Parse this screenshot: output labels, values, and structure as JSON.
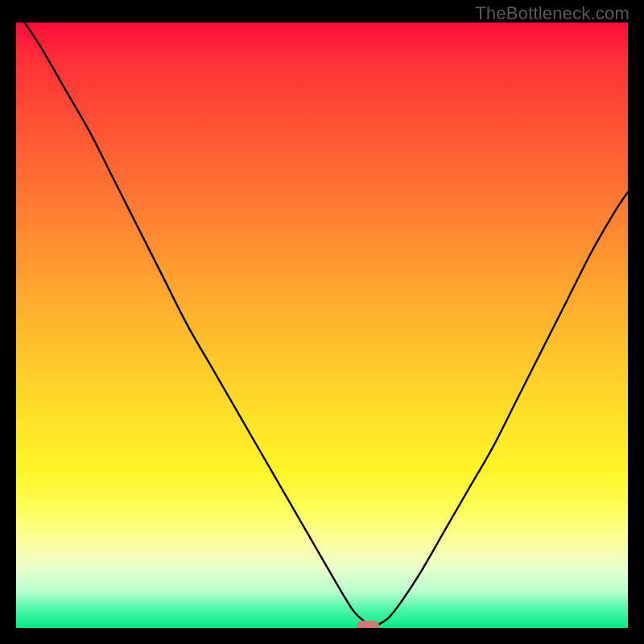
{
  "watermark": "TheBottleneck.com",
  "colors": {
    "page_bg": "#000000",
    "curve_stroke": "#000000",
    "marker_fill": "#cf7a75",
    "watermark_text": "#595959"
  },
  "chart_data": {
    "type": "line",
    "title": "",
    "xlabel": "",
    "ylabel": "",
    "xlim": [
      0,
      100
    ],
    "ylim": [
      0,
      100
    ],
    "grid": false,
    "legend": false,
    "series": [
      {
        "name": "curve",
        "x": [
          0,
          4,
          8,
          12,
          16,
          20,
          24,
          28,
          32,
          36,
          40,
          44,
          48,
          52,
          55,
          57,
          58,
          60,
          62,
          66,
          70,
          74,
          78,
          82,
          86,
          90,
          94,
          98,
          100
        ],
        "y": [
          102,
          96,
          89,
          82,
          74,
          66,
          58,
          50,
          43,
          36,
          29,
          22,
          15,
          8,
          3,
          1,
          0.3,
          1,
          3,
          9,
          16,
          23,
          30,
          38,
          46,
          54,
          62,
          69,
          72
        ]
      }
    ],
    "marker": {
      "x": 57.5,
      "y": 0.3
    },
    "gradient_stops": [
      {
        "pos": 0.0,
        "color": "#ff0b3a"
      },
      {
        "pos": 0.18,
        "color": "#ff5534"
      },
      {
        "pos": 0.43,
        "color": "#ffa32e"
      },
      {
        "pos": 0.66,
        "color": "#ffe328"
      },
      {
        "pos": 0.8,
        "color": "#fffe55"
      },
      {
        "pos": 0.94,
        "color": "#b7ffce"
      },
      {
        "pos": 1.0,
        "color": "#00ea88"
      }
    ]
  }
}
